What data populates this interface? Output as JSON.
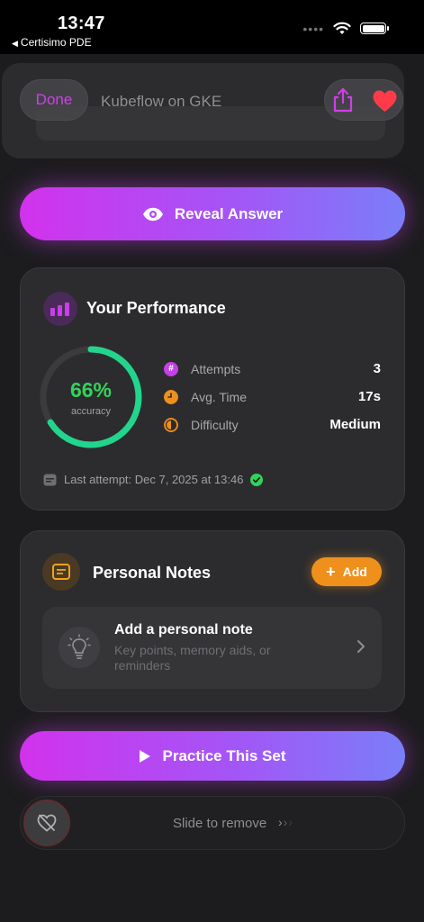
{
  "status_bar": {
    "time": "13:47",
    "back_app": "Certisimo PDE"
  },
  "nav": {
    "done_label": "Done",
    "title": "Kubeflow on GKE"
  },
  "reveal": {
    "label": "Reveal Answer"
  },
  "performance": {
    "title": "Your Performance",
    "accuracy_value": "66%",
    "accuracy_fraction": 0.66,
    "accuracy_label": "accuracy",
    "stats": [
      {
        "label": "Attempts",
        "value": "3"
      },
      {
        "label": "Avg. Time",
        "value": "17s"
      },
      {
        "label": "Difficulty",
        "value": "Medium"
      }
    ],
    "last_attempt": "Last attempt: Dec 7, 2025 at 13:46"
  },
  "notes": {
    "title": "Personal Notes",
    "add_label": "Add",
    "add_note_title": "Add a personal note",
    "add_note_subtitle": "Key points, memory aids, or reminders"
  },
  "practice": {
    "label": "Practice This Set"
  },
  "slider": {
    "label": "Slide to remove",
    "arrows": [
      "›",
      "›",
      "›"
    ]
  },
  "colors": {
    "accent_gradient_start": "#d232ec",
    "accent_gradient_end": "#7a7ef9",
    "success": "#32d35a",
    "orange": "#f0901c",
    "heart": "#ff3b4a"
  }
}
